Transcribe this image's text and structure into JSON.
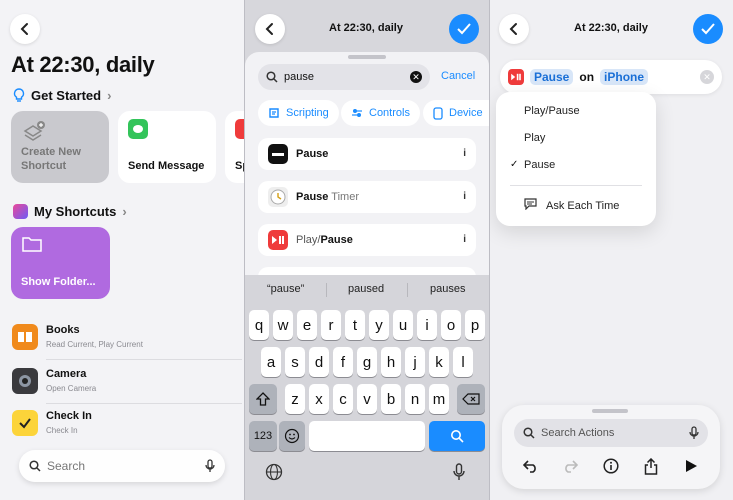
{
  "panel1": {
    "title": "At 22:30, daily",
    "get_started": "Get Started",
    "tiles": [
      {
        "label": "Create New Shortcut"
      },
      {
        "label": "Send Message"
      },
      {
        "label": "Sp"
      }
    ],
    "my_shortcuts": "My Shortcuts",
    "folder_tile": "Show Folder...",
    "apps": [
      {
        "name": "Books",
        "sub": "Read Current, Play Current"
      },
      {
        "name": "Camera",
        "sub": "Open Camera"
      },
      {
        "name": "Check In",
        "sub": "Check In"
      }
    ],
    "search_placeholder": "Search"
  },
  "panel2": {
    "title": "At 22:30, daily",
    "search_value": "pause",
    "cancel": "Cancel",
    "chips": [
      "Scripting",
      "Controls",
      "Device"
    ],
    "results": [
      {
        "prefix": "",
        "bold": "Pause",
        "suffix": ""
      },
      {
        "prefix": "",
        "bold": "Pause",
        "suffix": " Timer"
      },
      {
        "prefix": "Play/",
        "bold": "Pause",
        "suffix": ""
      }
    ],
    "info": "i",
    "suggestions": [
      "“pause”",
      "paused",
      "pauses"
    ],
    "keys_row1": [
      "q",
      "w",
      "e",
      "r",
      "t",
      "y",
      "u",
      "i",
      "o",
      "p"
    ],
    "keys_row2": [
      "a",
      "s",
      "d",
      "f",
      "g",
      "h",
      "j",
      "k",
      "l"
    ],
    "keys_row3": [
      "z",
      "x",
      "c",
      "v",
      "b",
      "n",
      "m"
    ],
    "key_123": "123"
  },
  "panel3": {
    "title": "At 22:30, daily",
    "token_action": "Pause",
    "on_text": "on",
    "token_device": "iPhone",
    "menu": [
      "Play/Pause",
      "Play",
      "Pause"
    ],
    "checked": "Pause",
    "ask": "Ask Each Time",
    "search_placeholder": "Search Actions"
  },
  "colors": {
    "accent": "#1a8cff",
    "folder": "#b06ae0"
  }
}
